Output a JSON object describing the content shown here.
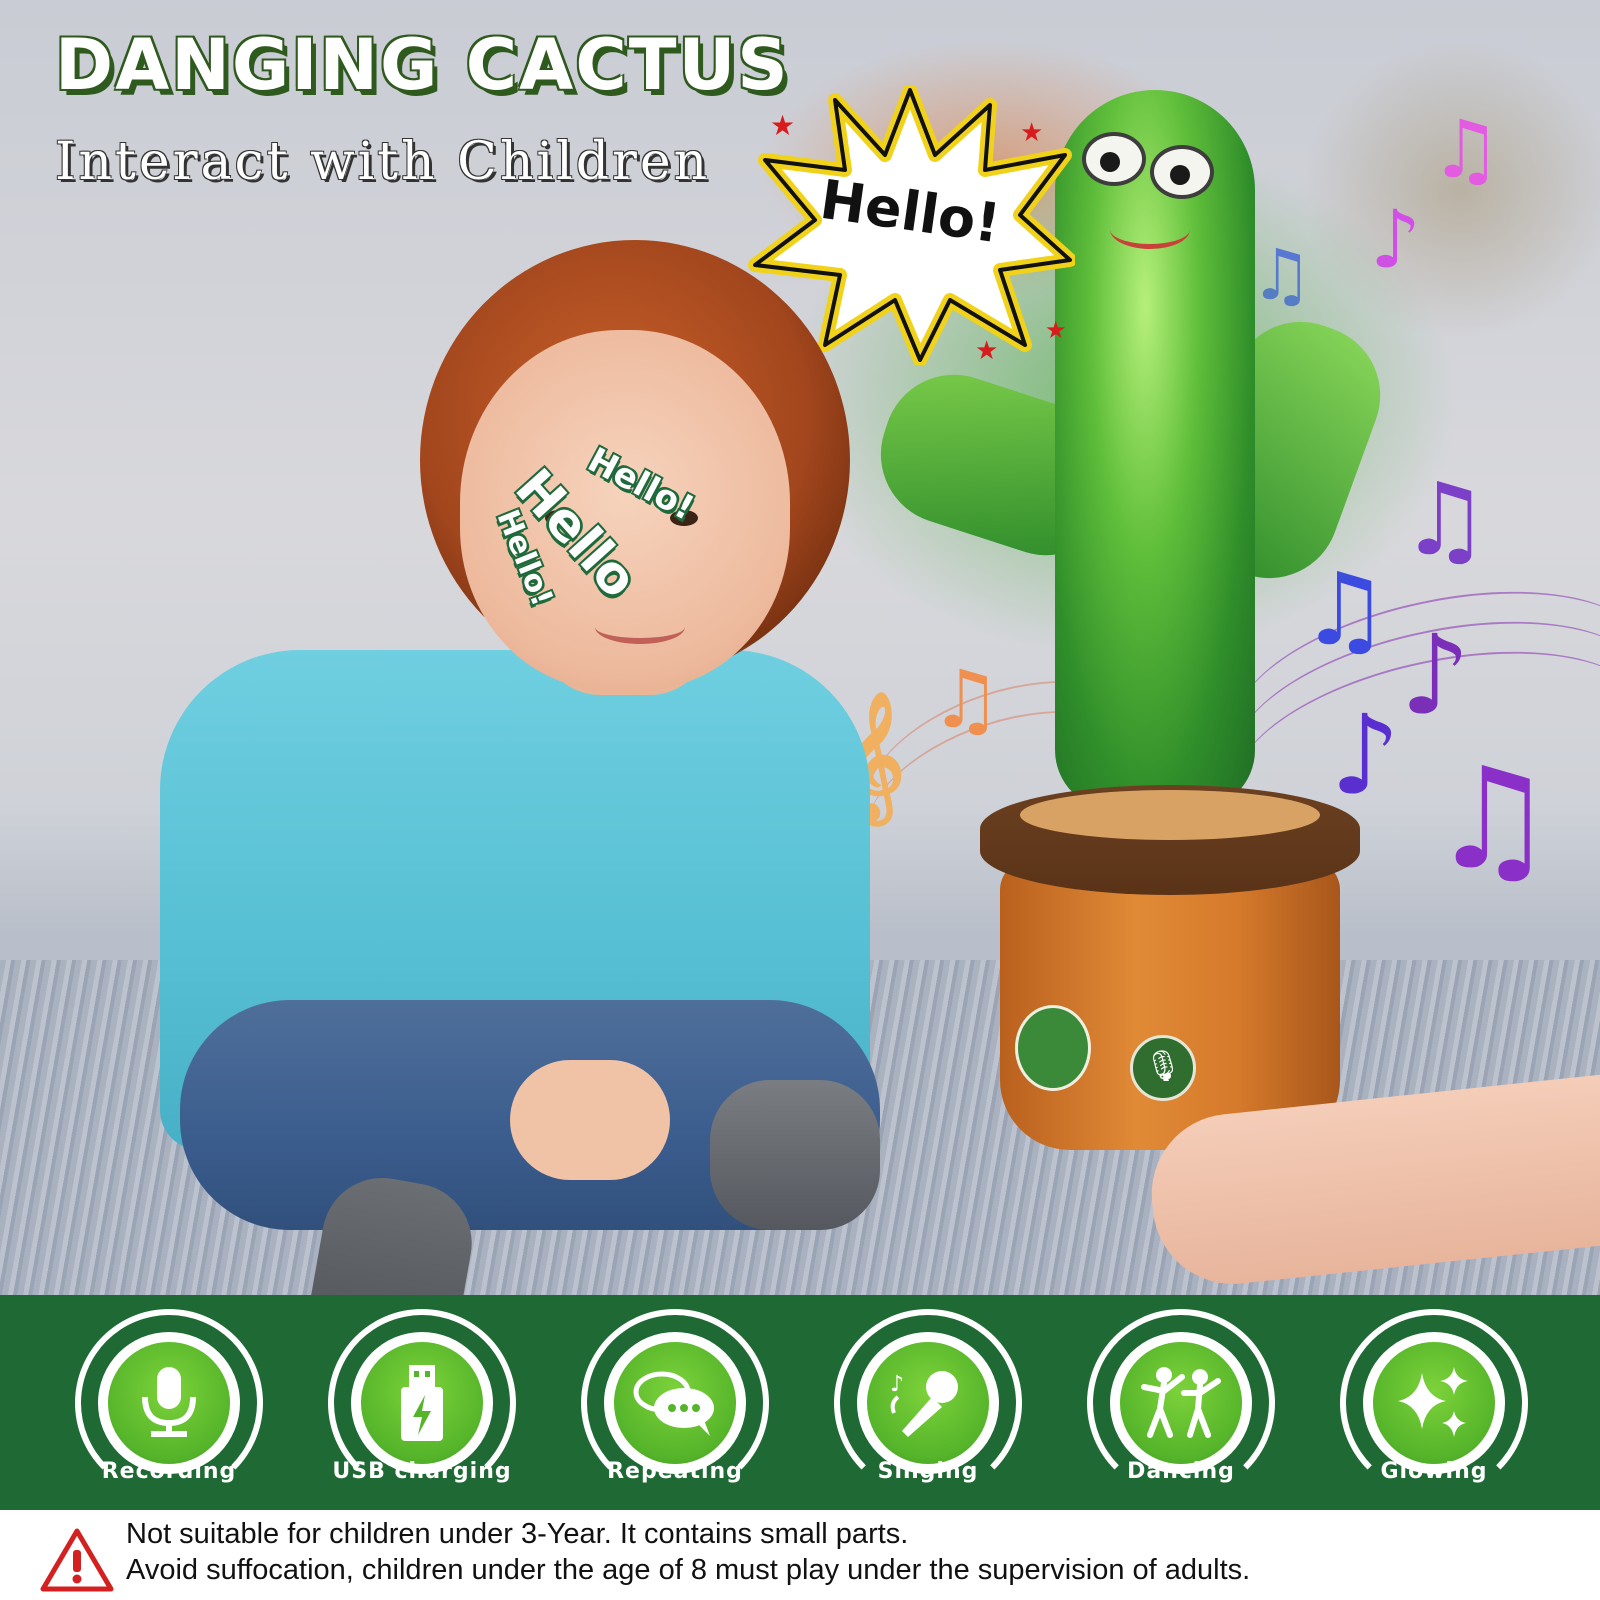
{
  "title": "DANGING CACTUS",
  "subtitle": "Interact with Children",
  "speech": {
    "burst": "Hello!",
    "child_small_1": "Hello!",
    "child_large": "Hello",
    "child_small_2": "Hello!"
  },
  "features": [
    {
      "label": "Recording",
      "icon": "microphone-icon"
    },
    {
      "label": "USB charging",
      "icon": "usb-icon"
    },
    {
      "label": "Repeating",
      "icon": "speech-bubbles-icon"
    },
    {
      "label": "Singing",
      "icon": "karaoke-mic-icon"
    },
    {
      "label": "Dancing",
      "icon": "dancing-people-icon"
    },
    {
      "label": "Glowing",
      "icon": "sparkles-icon"
    }
  ],
  "warning": {
    "line1": "Not suitable for children under 3-Year. It contains small parts.",
    "line2": "Avoid suffocation, children under the age of 8 must play under the supervision of adults."
  },
  "colors": {
    "band_green": "#1f6a34",
    "feature_green": "#55b42a",
    "title_underline": "#f3e000",
    "warning_red": "#d32020"
  }
}
